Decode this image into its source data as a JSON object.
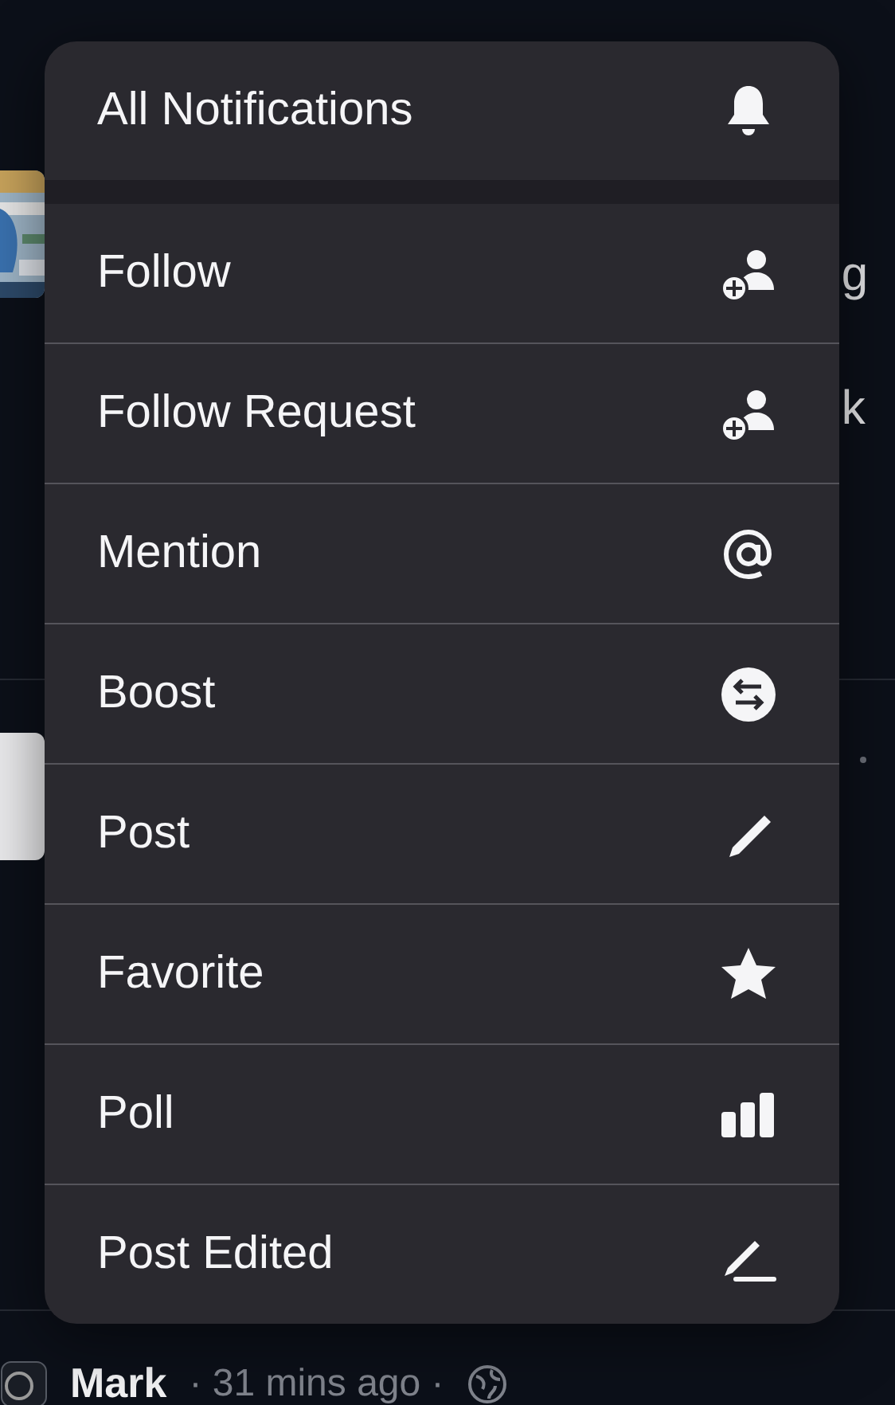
{
  "background": {
    "fragments": [
      "g",
      "k"
    ],
    "author": "Mark",
    "meta": "· 31 mins ago ·"
  },
  "menu": {
    "header": {
      "label": "All Notifications",
      "kind": "bell"
    },
    "items": [
      {
        "label": "Follow",
        "kind": "person-add"
      },
      {
        "label": "Follow Request",
        "kind": "person-add"
      },
      {
        "label": "Mention",
        "kind": "at"
      },
      {
        "label": "Boost",
        "kind": "boost"
      },
      {
        "label": "Post",
        "kind": "pencil"
      },
      {
        "label": "Favorite",
        "kind": "star"
      },
      {
        "label": "Poll",
        "kind": "poll"
      },
      {
        "label": "Post Edited",
        "kind": "pencil-line"
      }
    ]
  }
}
